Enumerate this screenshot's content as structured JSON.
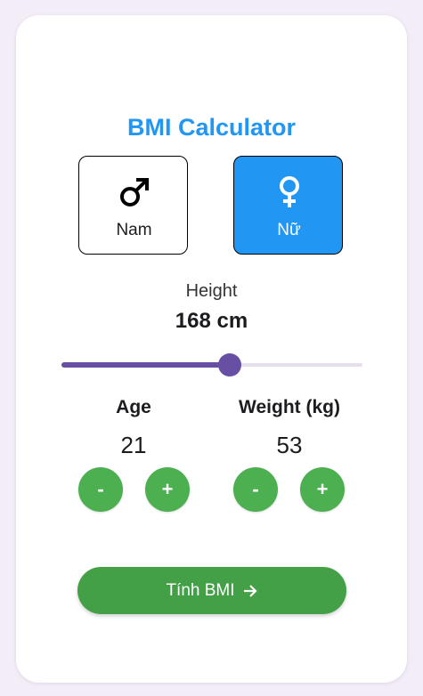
{
  "app": {
    "title": "BMI Calculator"
  },
  "gender": {
    "options": [
      {
        "label": "Nam",
        "icon": "male-icon"
      },
      {
        "label": "Nữ",
        "icon": "female-icon"
      }
    ],
    "selected": "Nữ"
  },
  "height": {
    "label": "Height",
    "value_text": "168 cm",
    "slider_fraction": 0.56
  },
  "age": {
    "label": "Age",
    "value": "21",
    "minus_label": "-",
    "plus_label": "+"
  },
  "weight": {
    "label": "Weight (kg)",
    "value": "53",
    "minus_label": "-",
    "plus_label": "+"
  },
  "calculate": {
    "label": "Tính BMI",
    "icon": "arrow-right-icon"
  },
  "colors": {
    "accent": "#2196f3",
    "slider": "#6750a4",
    "button_green": "#4caf50",
    "calc_green": "#43a047"
  }
}
